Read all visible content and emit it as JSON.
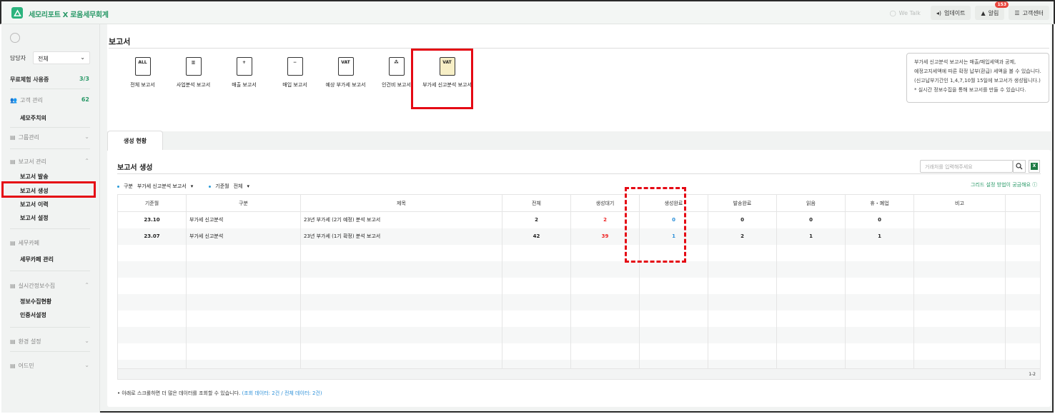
{
  "topbar": {
    "brand": "세모리포트 X 로움세무회계",
    "wetalk": "We Talk",
    "update": "업데이트",
    "alarm": "알림",
    "alarm_count": "153",
    "support": "고객센터"
  },
  "sidebar": {
    "manager_label": "담당자",
    "manager_value": "전체",
    "trial_label": "무료체험 사용중",
    "trial_count": "3/3",
    "client_mgmt": "고객 관리",
    "client_count": "62",
    "semo_value": "세모주치의",
    "group_mgmt": "그룹관리",
    "report_mgmt": "보고서 관리",
    "report_send": "보고서 발송",
    "report_create": "보고서 생성",
    "report_history": "보고서 이력",
    "report_settings": "보고서 설정",
    "tax_cafe": "세무카페",
    "tax_cafe_mgmt": "세무카페 관리",
    "realtime": "실시간정보수집",
    "info_status": "정보수집현황",
    "cert_settings": "인증서설정",
    "env_settings": "환경 설정",
    "admin": "어드민"
  },
  "main": {
    "page_title": "보고서",
    "reports": [
      {
        "label": "전체 보고서",
        "icon": "ALL"
      },
      {
        "label": "사업분석 보고서",
        "icon": ""
      },
      {
        "label": "매출 보고서",
        "icon": ""
      },
      {
        "label": "매입 보고서",
        "icon": ""
      },
      {
        "label": "예상 부가세 보고서",
        "icon": "VAT"
      },
      {
        "label": "인건비 보고서",
        "icon": ""
      },
      {
        "label": "부가세 신고분석 보고서",
        "icon": "VAT"
      }
    ],
    "info_lines": [
      "부가세 신고분석 보고서는 매출/매입세액과 공제,",
      "예정고지세액에 따른 확정 납부(환급) 세액을 볼 수 있습니다.",
      "(신고납부기간인 1,4,7,10월 15일에 보고서가 생성됩니다.)",
      "* 실시간 정보수집을 통해 보고서를 만들 수 있습니다."
    ],
    "tab_label": "생성 현황",
    "panel_title": "보고서 생성",
    "search_placeholder": "거래처를 입력해주세요",
    "filter_type_label": "구분",
    "filter_type_value": "부가세 신고분석 보고서",
    "filter_month_label": "기준월",
    "filter_month_value": "전체",
    "help_link": "그리드 설정 방법이 궁금해요",
    "columns": [
      "기준월",
      "구분",
      "제목",
      "전체",
      "생성대기",
      "생성완료",
      "발송완료",
      "읽음",
      "휴・폐업",
      "비고"
    ],
    "rows": [
      {
        "month": "23.10",
        "type": "부가세 신고분석",
        "title": "23년 부가세 (2기 예정) 분석 보고서",
        "total": "2",
        "pending": "2",
        "done": "0",
        "sent": "0",
        "read": "0",
        "closed": "0",
        "note": ""
      },
      {
        "month": "23.07",
        "type": "부가세 신고분석",
        "title": "23년 부가세 (1기 확정) 분석 보고서",
        "total": "42",
        "pending": "39",
        "done": "1",
        "sent": "2",
        "read": "1",
        "closed": "1",
        "note": ""
      }
    ],
    "pager": "1-2",
    "footnote_prefix": "• 아래로 스크롤하면 더 많은 데이터를 조회할 수 있습니다.",
    "footnote_link": "(조회 데이터: 2건 / 전체 데이터: 2건)"
  }
}
